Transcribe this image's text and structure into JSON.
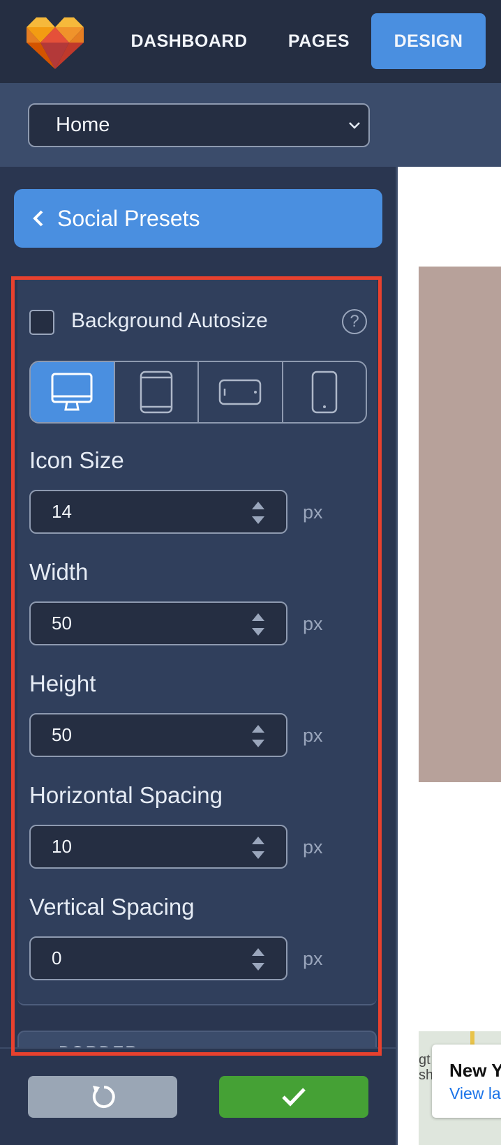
{
  "nav": {
    "items": [
      {
        "label": "DASHBOARD"
      },
      {
        "label": "PAGES"
      },
      {
        "label": "DESIGN",
        "active": true
      }
    ],
    "accent_color": "#4a8fe0"
  },
  "page_select": {
    "value": "Home"
  },
  "sidebar": {
    "back_label": "Social Presets",
    "background_autosize": {
      "label": "Background Autosize",
      "checked": false
    },
    "devices": [
      {
        "icon": "desktop-icon",
        "active": true
      },
      {
        "icon": "tablet-portrait-icon",
        "active": false
      },
      {
        "icon": "tablet-landscape-icon",
        "active": false
      },
      {
        "icon": "mobile-icon",
        "active": false
      }
    ],
    "fields": [
      {
        "label": "Icon Size",
        "value": "14",
        "unit": "px"
      },
      {
        "label": "Width",
        "value": "50",
        "unit": "px"
      },
      {
        "label": "Height",
        "value": "50",
        "unit": "px"
      },
      {
        "label": "Horizontal Spacing",
        "value": "10",
        "unit": "px"
      },
      {
        "label": "Vertical Spacing",
        "value": "0",
        "unit": "px"
      }
    ],
    "next_section_label": "BORDER"
  },
  "footer": {
    "reset_icon": "reset-icon",
    "save_icon": "checkmark-icon",
    "save_color": "#45a135"
  },
  "preview": {
    "map_text": "gt\nshi",
    "map_card_title": "New Y",
    "map_card_link": "View la"
  },
  "highlight_color": "#e8412e"
}
